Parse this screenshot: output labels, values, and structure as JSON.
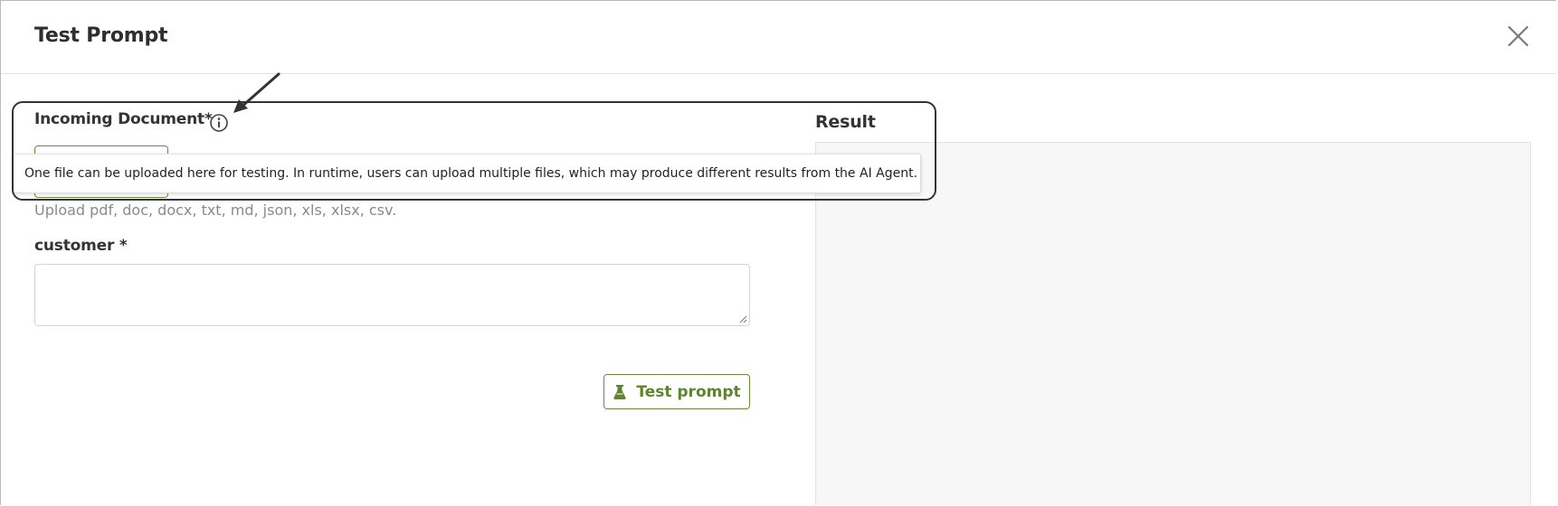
{
  "dialog": {
    "title": "Test Prompt",
    "close_icon": "close-icon"
  },
  "incoming_document": {
    "label": "Incoming Document*",
    "info_icon": "info-circle-icon",
    "helper": "Upload pdf, doc, docx, txt, md, json, xls, xlsx, csv."
  },
  "tooltip": {
    "text": "One file can be uploaded here for testing. In runtime, users can upload multiple files, which may produce different results from the AI Agent."
  },
  "customer": {
    "label": "customer *",
    "value": ""
  },
  "test_button": {
    "label": "Test prompt",
    "icon": "flask-icon"
  },
  "result": {
    "label": "Result"
  },
  "colors": {
    "accent": "#6a8c39",
    "result_bg": "#f7f7f7"
  }
}
